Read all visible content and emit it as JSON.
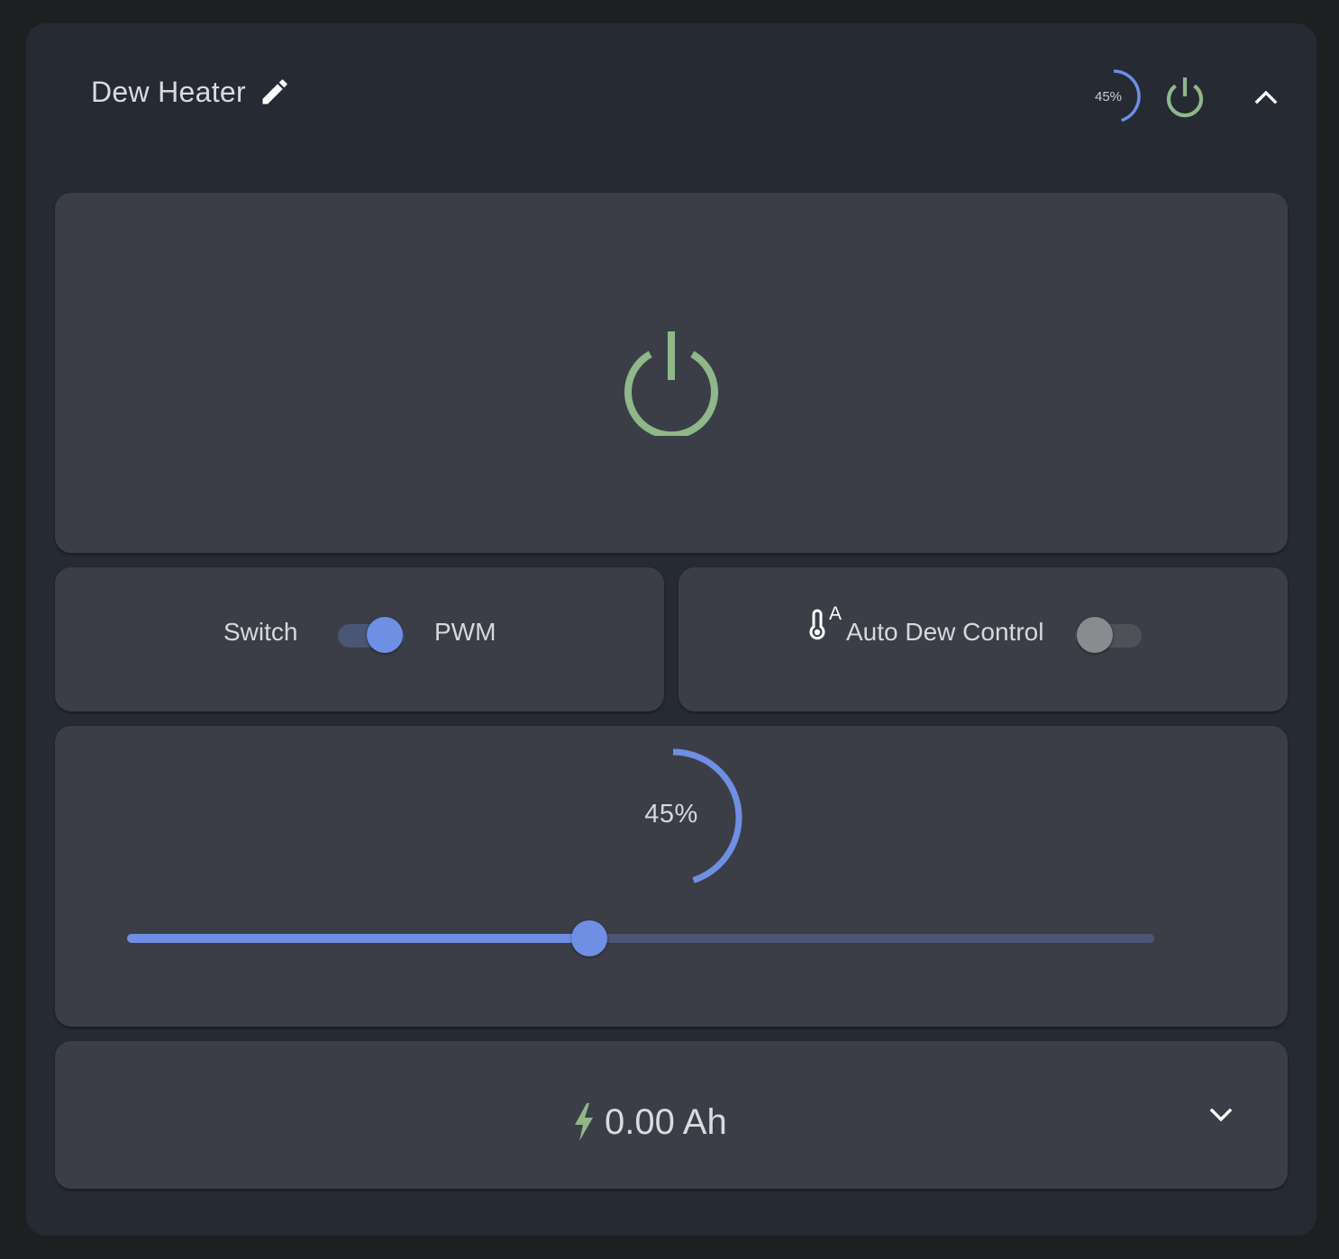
{
  "header": {
    "title": "Dew Heater",
    "mini_gauge_label": "45%",
    "icons": {
      "edit": "pencil-icon",
      "power": "power-icon",
      "collapse": "chevron-up-icon"
    }
  },
  "power_panel": {
    "state": "on",
    "icon": "power-icon",
    "color": "#8fb78a"
  },
  "mode_panel": {
    "left_label": "Switch",
    "right_label": "PWM",
    "mode_pwm_enabled": true
  },
  "auto_panel": {
    "icon": "thermometer-auto-icon",
    "label": "Auto Dew Control",
    "enabled": false
  },
  "level_panel": {
    "value": 45,
    "value_label": "45%",
    "min": 0,
    "max": 100
  },
  "energy_panel": {
    "icon": "lightning-bolt-icon",
    "value": "0.00 Ah",
    "expand_icon": "chevron-down-icon"
  },
  "colors": {
    "accent": "#6e8fe4",
    "power_on": "#8fb78a",
    "card_bg": "#262a32",
    "panel_bg": "#3b3e47"
  }
}
